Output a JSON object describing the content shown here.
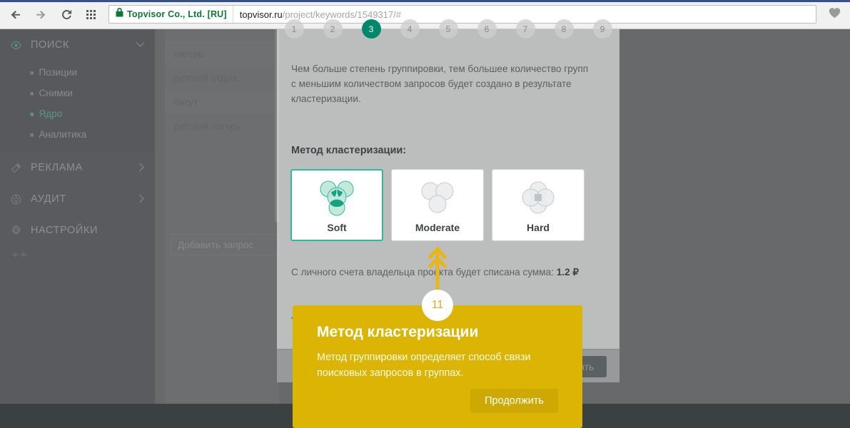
{
  "browser": {
    "back_icon": "arrow-left-icon",
    "forward_icon": "arrow-right-icon",
    "reload_icon": "reload-icon",
    "apps_icon": "apps-grid-icon",
    "lock_icon": "lock-icon",
    "site_identity": "Topvisor Co., Ltd. [RU]",
    "url_host": "topvisor.ru",
    "url_path": "/project/keywords/1549317/#",
    "bookmark_icon": "heart-icon"
  },
  "sidebar": {
    "groups": [
      {
        "label": "ПОИСК",
        "icon": "eye-icon",
        "expanded": true,
        "chevron": "chevron-down-icon",
        "items": [
          {
            "label": "Позиции",
            "current": false
          },
          {
            "label": "Снимки",
            "current": false
          },
          {
            "label": "Ядро",
            "current": true
          },
          {
            "label": "Аналитика",
            "current": false
          }
        ]
      },
      {
        "label": "РЕКЛАМА",
        "icon": "megaphone-icon",
        "expanded": false,
        "chevron": "chevron-right-icon",
        "items": []
      },
      {
        "label": "АУДИТ",
        "icon": "target-icon",
        "expanded": false,
        "chevron": "chevron-right-icon",
        "items": []
      },
      {
        "label": "НАСТРОЙКИ",
        "icon": "gear-icon",
        "expanded": false,
        "chevron": "",
        "items": []
      }
    ],
    "collapse_icon": "collapse-arrows-icon"
  },
  "keywords": {
    "rows": [
      "лагерь",
      "детский отдых",
      "батут",
      "детский лагерь"
    ],
    "add_placeholder": "Добавить запрос"
  },
  "modal": {
    "steps": [
      {
        "n": "1",
        "active": false
      },
      {
        "n": "2",
        "active": false
      },
      {
        "n": "3",
        "active": true
      },
      {
        "n": "4",
        "active": false
      },
      {
        "n": "5",
        "active": false
      },
      {
        "n": "6",
        "active": false
      },
      {
        "n": "7",
        "active": false
      },
      {
        "n": "8",
        "active": false
      },
      {
        "n": "9",
        "active": false
      }
    ],
    "description": "Чем больше степень группировки, тем большее количество групп с меньшим количеством запросов будет создано в результате кластеризации.",
    "method_label": "Метод кластеризации:",
    "methods": [
      {
        "label": "Soft",
        "icon": "venn-soft-icon",
        "selected": true
      },
      {
        "label": "Moderate",
        "icon": "venn-moderate-icon",
        "selected": false
      },
      {
        "label": "Hard",
        "icon": "venn-hard-icon",
        "selected": false
      }
    ],
    "price_text": "С личного счета владельца проекта будет списана сумма:",
    "price_amount": "1.2 ₽",
    "warning_icon": "warning-triangle-icon",
    "warning_text": "Кластеризация запустится для всех запросов проекта.",
    "submit_label": "Кластеризовать"
  },
  "tour": {
    "arrow_icon": "arrow-up-icon",
    "step": "11",
    "title": "Метод кластеризации",
    "body": "Метод группировки определяет способ связи поисковых запросов в группах.",
    "continue_label": "Продолжить"
  },
  "colors": {
    "accent_teal": "#1bb98c",
    "step_active": "#00886b",
    "tour_yellow": "#dcb504",
    "tour_button": "#cfa903",
    "sidebar_bg": "#171c24",
    "secure_green": "#0b7a35"
  }
}
